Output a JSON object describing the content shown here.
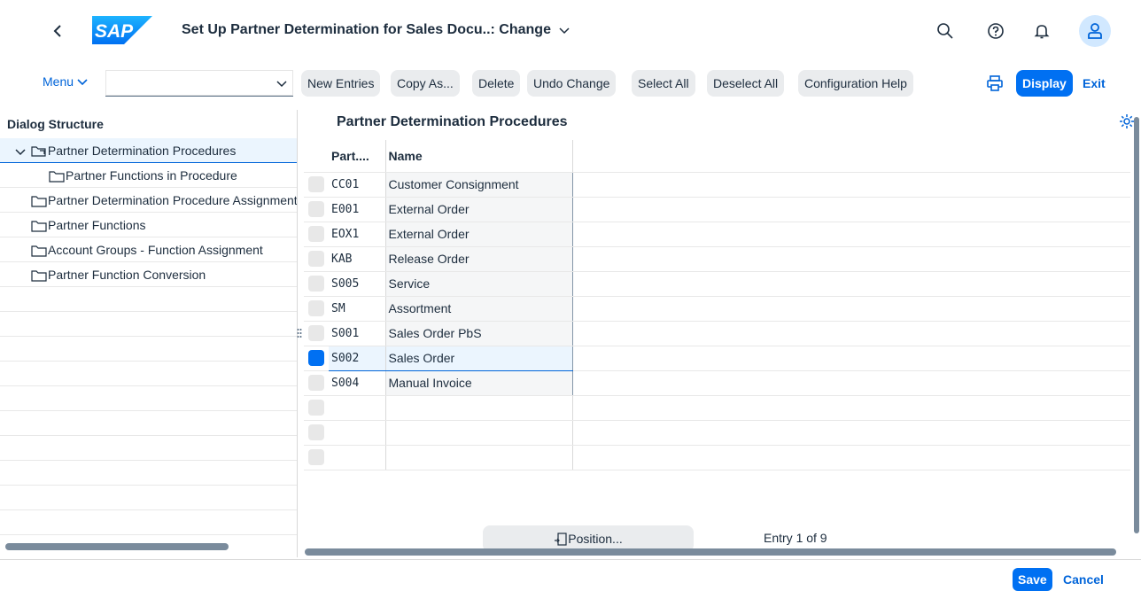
{
  "shell": {
    "logo_text": "SAP",
    "title": "Set Up Partner Determination for Sales Docu..: Change",
    "icons": [
      "back-icon",
      "sap-logo",
      "title-chevron-icon",
      "search-icon",
      "help-icon",
      "bell-icon",
      "user-icon"
    ]
  },
  "toolbar": {
    "menu_label": "Menu",
    "combo_value": "",
    "new_entries": "New Entries",
    "copy_as": "Copy As...",
    "delete": "Delete",
    "undo_change": "Undo Change",
    "select_all": "Select All",
    "deselect_all": "Deselect All",
    "configuration_help": "Configuration Help",
    "display": "Display",
    "exit": "Exit"
  },
  "dialog_structure": {
    "title": "Dialog Structure",
    "items": [
      {
        "label": "Partner Determination Procedures",
        "level": 0,
        "expanded": true,
        "selected": true
      },
      {
        "label": "Partner Functions in Procedure",
        "level": 1,
        "expanded": false,
        "selected": false
      },
      {
        "label": "Partner Determination Procedure Assignment",
        "level": 0,
        "expanded": false,
        "selected": false
      },
      {
        "label": "Partner Functions",
        "level": 0,
        "expanded": false,
        "selected": false
      },
      {
        "label": "Account Groups - Function Assignment",
        "level": 0,
        "expanded": false,
        "selected": false
      },
      {
        "label": "Partner Function Conversion",
        "level": 0,
        "expanded": false,
        "selected": false
      }
    ]
  },
  "main": {
    "title": "Partner Determination Procedures",
    "columns": [
      "Part....",
      "Name"
    ],
    "rows": [
      {
        "code": "CC01",
        "name": "Customer Consignment",
        "selected": false
      },
      {
        "code": "E001",
        "name": "External Order",
        "selected": false
      },
      {
        "code": "EOX1",
        "name": "External Order",
        "selected": false
      },
      {
        "code": "KAB",
        "name": "Release Order",
        "selected": false
      },
      {
        "code": "S005",
        "name": "Service",
        "selected": false
      },
      {
        "code": "SM",
        "name": "Assortment",
        "selected": false
      },
      {
        "code": "S001",
        "name": "Sales Order PbS",
        "selected": false
      },
      {
        "code": "S002",
        "name": "Sales Order",
        "selected": true
      },
      {
        "code": "S004",
        "name": "Manual Invoice",
        "selected": false
      }
    ],
    "empty_rows": 3,
    "position_label": "Position...",
    "entry_text": "Entry 1 of 9"
  },
  "footer": {
    "save": "Save",
    "cancel": "Cancel"
  },
  "colors": {
    "accent": "#0070f2",
    "link": "#0064d9",
    "text": "#1d2d3e",
    "button_bg": "#eaecee",
    "selection_bg": "#ebf5fe"
  }
}
